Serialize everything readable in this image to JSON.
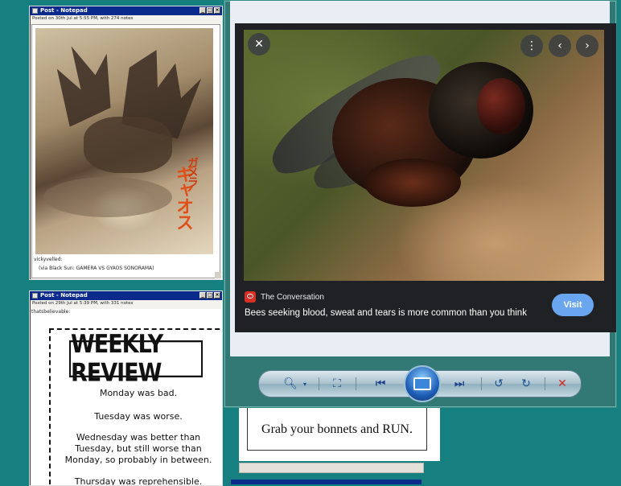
{
  "post1": {
    "title": "Post - Notepad",
    "meta": "Posted on 30th Jul at 5:55 PM, with 274 notes",
    "author": "vickyvelled:",
    "caption": "(via Black Sun: GAMERA VS GYAOS SONORAMA)"
  },
  "post2": {
    "title": "Post - Notepad",
    "meta": "Posted on 29th Jul at 5:39 PM, with 331 notes",
    "author": "thatsbelievable:",
    "card": {
      "title": "WEEKLY REVIEW",
      "lines": [
        "Monday was bad.",
        "Tuesday was worse.",
        "Wednesday was better than",
        "Tuesday, but still worse than",
        "Monday, so probably in between.",
        "Thursday was reprehensible."
      ]
    }
  },
  "lens": {
    "source": "The Conversation",
    "headline": "Bees seeking blood, sweat and tears is more common than you think",
    "visit_label": "Visit"
  },
  "bonnets": {
    "text": "Grab your bonnets and RUN."
  },
  "icons": {
    "close": "close-icon",
    "more": "more-vert-icon",
    "prev": "chevron-left-icon",
    "next": "chevron-right-icon"
  },
  "toolbar": {
    "zoom": "zoom-icon",
    "actual_size": "fit-window-icon",
    "previous": "previous-icon",
    "slideshow": "slideshow-icon",
    "next": "next-icon",
    "rotate_ccw": "rotate-ccw-icon",
    "rotate_cw": "rotate-cw-icon",
    "delete": "delete-icon"
  }
}
